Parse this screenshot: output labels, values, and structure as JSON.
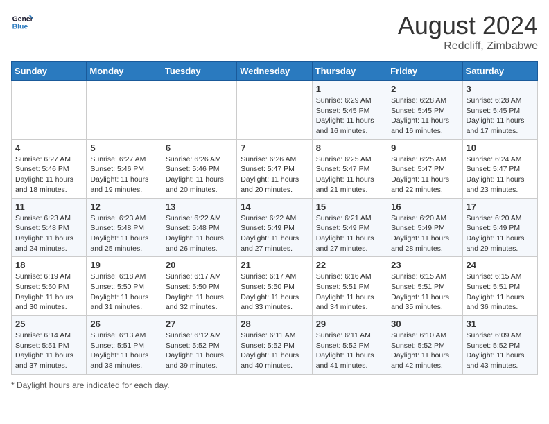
{
  "logo": {
    "text_general": "General",
    "text_blue": "Blue"
  },
  "title": {
    "month_year": "August 2024",
    "location": "Redcliff, Zimbabwe"
  },
  "days_of_week": [
    "Sunday",
    "Monday",
    "Tuesday",
    "Wednesday",
    "Thursday",
    "Friday",
    "Saturday"
  ],
  "footer": {
    "note": "Daylight hours"
  },
  "weeks": [
    [
      {
        "day": "",
        "info": ""
      },
      {
        "day": "",
        "info": ""
      },
      {
        "day": "",
        "info": ""
      },
      {
        "day": "",
        "info": ""
      },
      {
        "day": "1",
        "info": "Sunrise: 6:29 AM\nSunset: 5:45 PM\nDaylight: 11 hours and 16 minutes."
      },
      {
        "day": "2",
        "info": "Sunrise: 6:28 AM\nSunset: 5:45 PM\nDaylight: 11 hours and 16 minutes."
      },
      {
        "day": "3",
        "info": "Sunrise: 6:28 AM\nSunset: 5:45 PM\nDaylight: 11 hours and 17 minutes."
      }
    ],
    [
      {
        "day": "4",
        "info": "Sunrise: 6:27 AM\nSunset: 5:46 PM\nDaylight: 11 hours and 18 minutes."
      },
      {
        "day": "5",
        "info": "Sunrise: 6:27 AM\nSunset: 5:46 PM\nDaylight: 11 hours and 19 minutes."
      },
      {
        "day": "6",
        "info": "Sunrise: 6:26 AM\nSunset: 5:46 PM\nDaylight: 11 hours and 20 minutes."
      },
      {
        "day": "7",
        "info": "Sunrise: 6:26 AM\nSunset: 5:47 PM\nDaylight: 11 hours and 20 minutes."
      },
      {
        "day": "8",
        "info": "Sunrise: 6:25 AM\nSunset: 5:47 PM\nDaylight: 11 hours and 21 minutes."
      },
      {
        "day": "9",
        "info": "Sunrise: 6:25 AM\nSunset: 5:47 PM\nDaylight: 11 hours and 22 minutes."
      },
      {
        "day": "10",
        "info": "Sunrise: 6:24 AM\nSunset: 5:47 PM\nDaylight: 11 hours and 23 minutes."
      }
    ],
    [
      {
        "day": "11",
        "info": "Sunrise: 6:23 AM\nSunset: 5:48 PM\nDaylight: 11 hours and 24 minutes."
      },
      {
        "day": "12",
        "info": "Sunrise: 6:23 AM\nSunset: 5:48 PM\nDaylight: 11 hours and 25 minutes."
      },
      {
        "day": "13",
        "info": "Sunrise: 6:22 AM\nSunset: 5:48 PM\nDaylight: 11 hours and 26 minutes."
      },
      {
        "day": "14",
        "info": "Sunrise: 6:22 AM\nSunset: 5:49 PM\nDaylight: 11 hours and 27 minutes."
      },
      {
        "day": "15",
        "info": "Sunrise: 6:21 AM\nSunset: 5:49 PM\nDaylight: 11 hours and 27 minutes."
      },
      {
        "day": "16",
        "info": "Sunrise: 6:20 AM\nSunset: 5:49 PM\nDaylight: 11 hours and 28 minutes."
      },
      {
        "day": "17",
        "info": "Sunrise: 6:20 AM\nSunset: 5:49 PM\nDaylight: 11 hours and 29 minutes."
      }
    ],
    [
      {
        "day": "18",
        "info": "Sunrise: 6:19 AM\nSunset: 5:50 PM\nDaylight: 11 hours and 30 minutes."
      },
      {
        "day": "19",
        "info": "Sunrise: 6:18 AM\nSunset: 5:50 PM\nDaylight: 11 hours and 31 minutes."
      },
      {
        "day": "20",
        "info": "Sunrise: 6:17 AM\nSunset: 5:50 PM\nDaylight: 11 hours and 32 minutes."
      },
      {
        "day": "21",
        "info": "Sunrise: 6:17 AM\nSunset: 5:50 PM\nDaylight: 11 hours and 33 minutes."
      },
      {
        "day": "22",
        "info": "Sunrise: 6:16 AM\nSunset: 5:51 PM\nDaylight: 11 hours and 34 minutes."
      },
      {
        "day": "23",
        "info": "Sunrise: 6:15 AM\nSunset: 5:51 PM\nDaylight: 11 hours and 35 minutes."
      },
      {
        "day": "24",
        "info": "Sunrise: 6:15 AM\nSunset: 5:51 PM\nDaylight: 11 hours and 36 minutes."
      }
    ],
    [
      {
        "day": "25",
        "info": "Sunrise: 6:14 AM\nSunset: 5:51 PM\nDaylight: 11 hours and 37 minutes."
      },
      {
        "day": "26",
        "info": "Sunrise: 6:13 AM\nSunset: 5:51 PM\nDaylight: 11 hours and 38 minutes."
      },
      {
        "day": "27",
        "info": "Sunrise: 6:12 AM\nSunset: 5:52 PM\nDaylight: 11 hours and 39 minutes."
      },
      {
        "day": "28",
        "info": "Sunrise: 6:11 AM\nSunset: 5:52 PM\nDaylight: 11 hours and 40 minutes."
      },
      {
        "day": "29",
        "info": "Sunrise: 6:11 AM\nSunset: 5:52 PM\nDaylight: 11 hours and 41 minutes."
      },
      {
        "day": "30",
        "info": "Sunrise: 6:10 AM\nSunset: 5:52 PM\nDaylight: 11 hours and 42 minutes."
      },
      {
        "day": "31",
        "info": "Sunrise: 6:09 AM\nSunset: 5:52 PM\nDaylight: 11 hours and 43 minutes."
      }
    ]
  ]
}
